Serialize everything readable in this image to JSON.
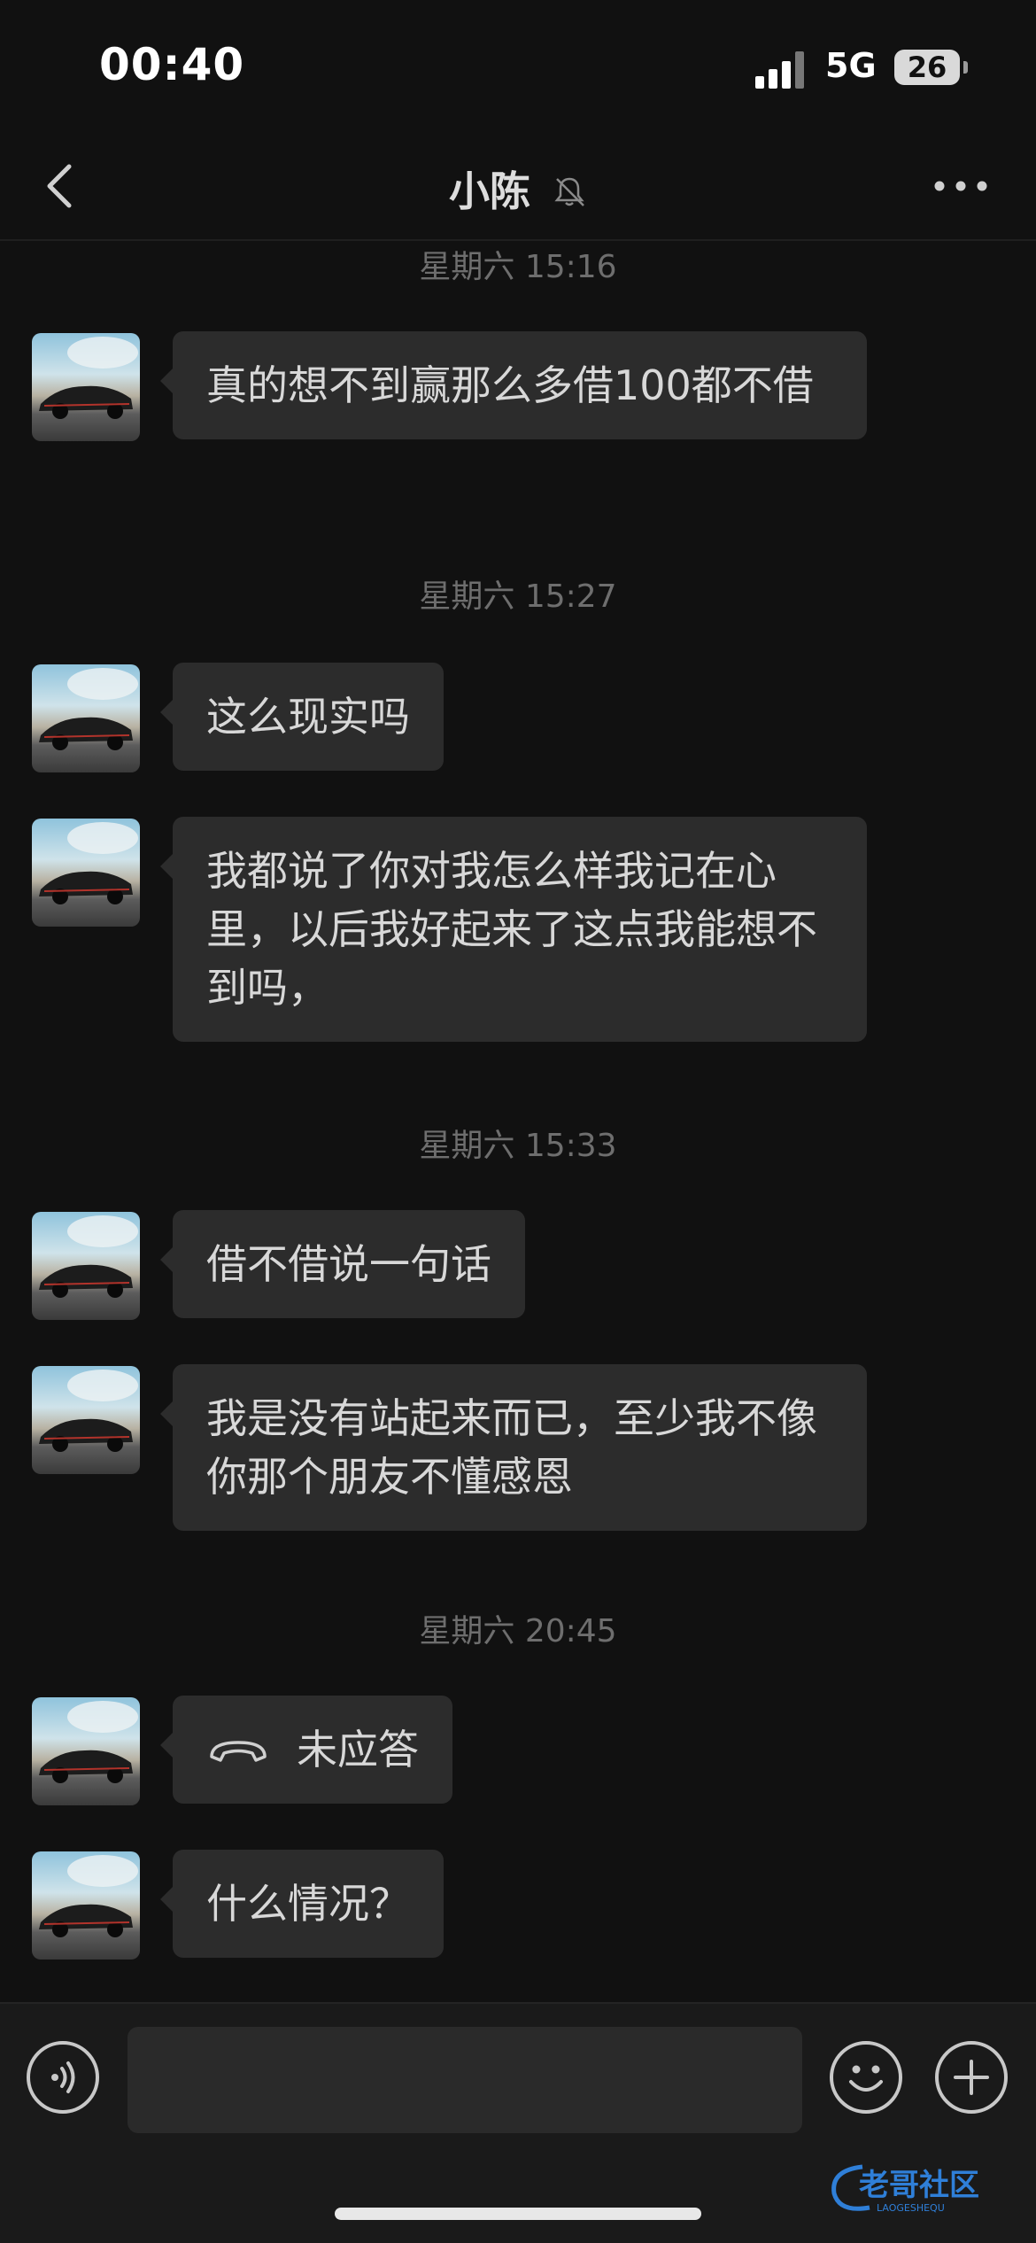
{
  "status_bar": {
    "time": "00:40",
    "network": "5G",
    "battery": "26"
  },
  "nav": {
    "title": "小陈",
    "mute_icon": "bell-slash-icon",
    "back_icon": "chevron-left-icon",
    "more_icon": "ellipsis-icon"
  },
  "timestamps": [
    "星期六 15:16",
    "星期六 15:27",
    "星期六 15:33",
    "星期六 20:45"
  ],
  "messages": [
    {
      "text": "真的想不到赢那么多借100都不借"
    },
    {
      "text": "这么现实吗"
    },
    {
      "text": "我都说了你对我怎么样我记在心里，以后我好起来了这点我能想不到吗，"
    },
    {
      "text": "借不借说一句话"
    },
    {
      "text": "我是没有站起来而已，至少我不像你那个朋友不懂感恩"
    },
    {
      "text": "未应答",
      "icon": "phone-hangup-icon"
    },
    {
      "text": "什么情况？"
    }
  ],
  "input_bar": {
    "placeholder": "",
    "voice_icon": "voice-icon",
    "emoji_icon": "emoji-icon",
    "plus_icon": "plus-icon"
  },
  "watermark": {
    "text": "老哥社区",
    "subtext": "LAOGESHEQU"
  },
  "colors": {
    "background": "#111111",
    "bubble": "#2c2c2c",
    "text": "#d8d8d8",
    "timestamp": "#6e6e6e"
  }
}
